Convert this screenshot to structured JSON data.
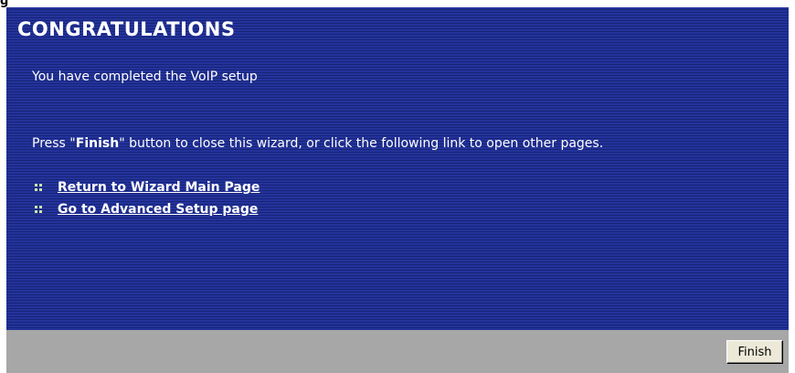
{
  "header": {
    "fragment": "g"
  },
  "wizard": {
    "title": "CONGRATULATIONS",
    "completed_text": "You have completed the VoIP setup",
    "instruction_prefix": "Press \"",
    "instruction_bold": "Finish",
    "instruction_suffix": "\" button to close this wizard, or click the following link to open other pages.",
    "links": [
      {
        "label": "Return to Wizard Main Page",
        "icon": "grid-bullet-icon"
      },
      {
        "label": "Go to Advanced Setup page",
        "icon": "grid-bullet-icon"
      }
    ]
  },
  "footer": {
    "finish_label": "Finish"
  },
  "colors": {
    "panel_bg": "#1e2e8a",
    "footer_bg": "#a7a7a7",
    "bullet": "#c9e6a8",
    "text": "#ffffff"
  }
}
